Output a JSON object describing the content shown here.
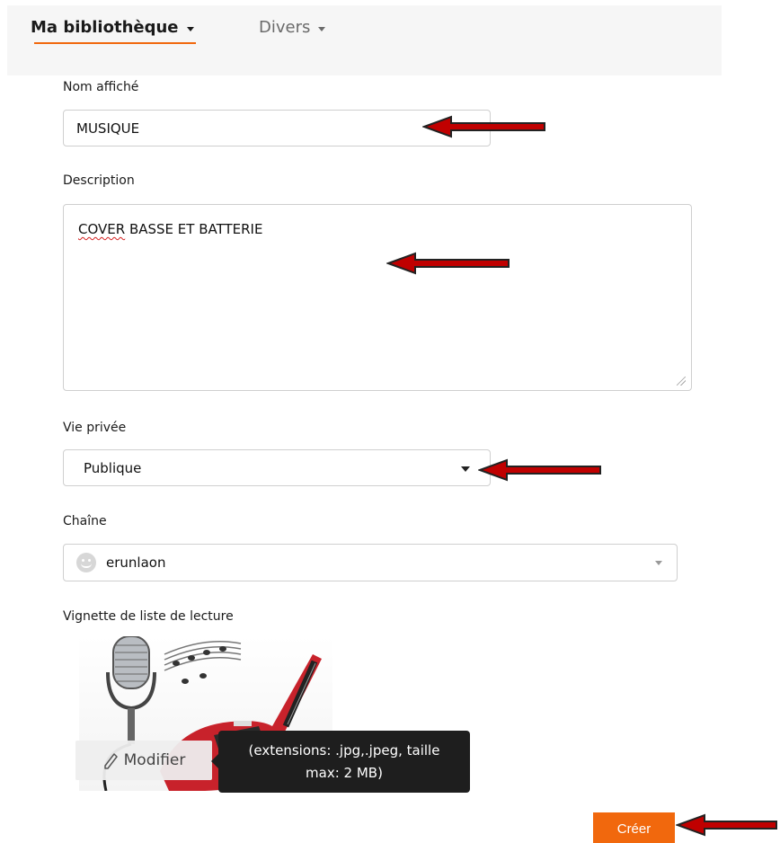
{
  "nav": {
    "library_label": "Ma bibliothèque",
    "misc_label": "Divers"
  },
  "form": {
    "name_label": "Nom affiché",
    "name_value": "MUSIQUE",
    "description_label": "Description",
    "description_value_word1": "COVER",
    "description_value_rest": " BASSE ET BATTERIE",
    "privacy_label": "Vie privée",
    "privacy_value": "Publique",
    "channel_label": "Chaîne",
    "channel_value": "erunlaon",
    "thumbnail_label": "Vignette de liste de lecture",
    "modify_label": "Modifier",
    "thumbnail_hint_line1": "(extensions: .jpg,.jpeg, taille",
    "thumbnail_hint_line2": "max: 2 MB)",
    "create_label": "Créer"
  },
  "colors": {
    "accent": "#f1680d",
    "annotation_arrow": "#c00000",
    "tooltip_bg": "#1e1e1e"
  }
}
